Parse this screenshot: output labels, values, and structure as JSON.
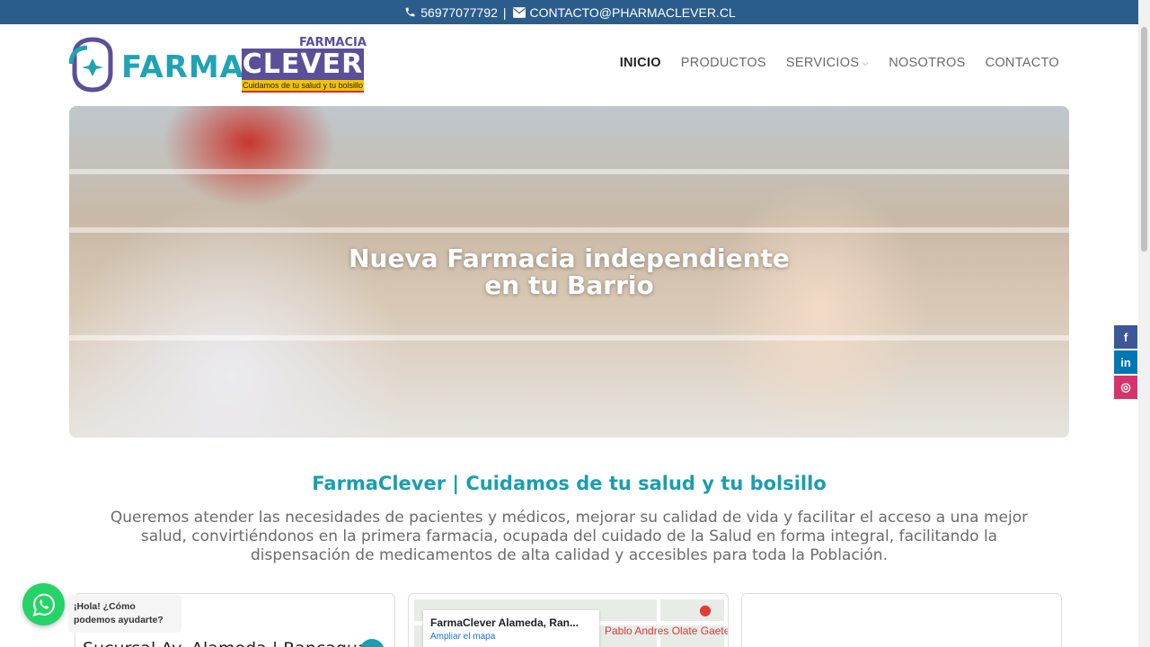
{
  "topbar": {
    "phone": "56977077792",
    "separator": "|",
    "email": "CONTACTO@PHARMACLEVER.CL"
  },
  "logo": {
    "word_farma": "FARMA",
    "word_farmacia": "FARMACIA",
    "word_clever": "CLEVER",
    "tagline": "Cuidamos de tu salud y tu bolsillo"
  },
  "nav": {
    "items": [
      "INICIO",
      "PRODUCTOS",
      "SERVICIOS",
      "NOSOTROS",
      "CONTACTO"
    ]
  },
  "hero": {
    "line1": "Nueva Farmacia independiente",
    "line2": "en tu Barrio"
  },
  "section": {
    "title": "FarmaClever | Cuidamos de tu salud y tu bolsillo",
    "description": "Queremos atender las necesidades de pacientes y médicos, mejorar su calidad de vida y facilitar el acceso a una mejor salud, convirtiéndonos en la primera farmacia, ocupada del cuidado de la Salud en forma integral, facilitando la dispensación de medicamentos de alta calidad y accesibles para toda la Población."
  },
  "cards": {
    "card1_title": "Sucursal Av. Alameda | Rancagua",
    "map_name": "FarmaClever Alameda, Ran...",
    "map_link": "Ampliar el mapa",
    "map_label": "Pablo Andres Olate Gaete"
  },
  "whatsapp": {
    "bubble_text": "¡Hola! ¿Cómo podemos ayudarte?"
  },
  "social": {
    "facebook": "f",
    "linkedin": "in",
    "instagram": "◎"
  },
  "colors": {
    "topbar": "#2a5d8c",
    "accent": "#1a9eb0",
    "brand_purple": "#5b4f9a",
    "whatsapp": "#25d366"
  }
}
